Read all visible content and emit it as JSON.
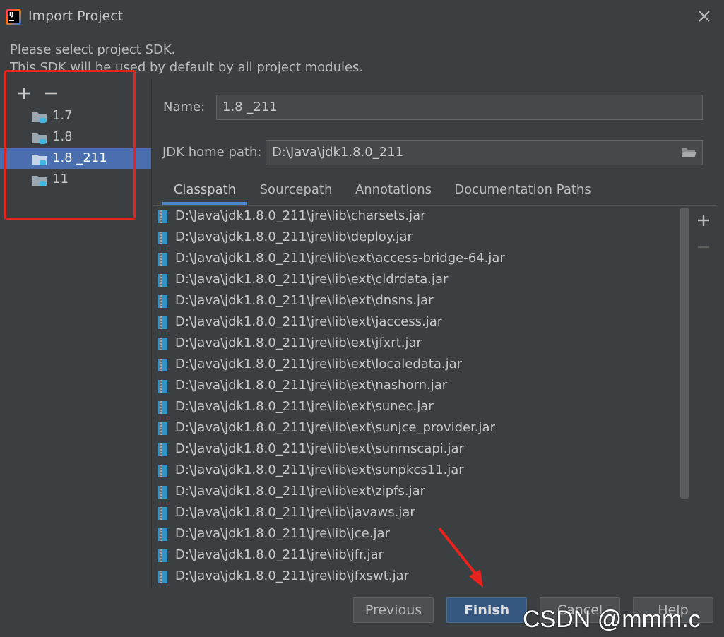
{
  "window": {
    "title": "Import Project"
  },
  "description": {
    "line1": "Please select project SDK.",
    "line2": "This SDK will be used by default by all project modules."
  },
  "sdk_list": [
    {
      "label": "1.7",
      "selected": false
    },
    {
      "label": "1.8",
      "selected": false
    },
    {
      "label": "1.8 _211",
      "selected": true
    },
    {
      "label": "11",
      "selected": false
    }
  ],
  "form": {
    "name_label": "Name:",
    "name_value": "1.8 _211",
    "jdk_label": "JDK home path:",
    "jdk_value": "D:\\Java\\jdk1.8.0_211"
  },
  "tabs": [
    {
      "label": "Classpath",
      "active": true
    },
    {
      "label": "Sourcepath",
      "active": false
    },
    {
      "label": "Annotations",
      "active": false
    },
    {
      "label": "Documentation Paths",
      "active": false
    }
  ],
  "classpath": [
    "D:\\Java\\jdk1.8.0_211\\jre\\lib\\charsets.jar",
    "D:\\Java\\jdk1.8.0_211\\jre\\lib\\deploy.jar",
    "D:\\Java\\jdk1.8.0_211\\jre\\lib\\ext\\access-bridge-64.jar",
    "D:\\Java\\jdk1.8.0_211\\jre\\lib\\ext\\cldrdata.jar",
    "D:\\Java\\jdk1.8.0_211\\jre\\lib\\ext\\dnsns.jar",
    "D:\\Java\\jdk1.8.0_211\\jre\\lib\\ext\\jaccess.jar",
    "D:\\Java\\jdk1.8.0_211\\jre\\lib\\ext\\jfxrt.jar",
    "D:\\Java\\jdk1.8.0_211\\jre\\lib\\ext\\localedata.jar",
    "D:\\Java\\jdk1.8.0_211\\jre\\lib\\ext\\nashorn.jar",
    "D:\\Java\\jdk1.8.0_211\\jre\\lib\\ext\\sunec.jar",
    "D:\\Java\\jdk1.8.0_211\\jre\\lib\\ext\\sunjce_provider.jar",
    "D:\\Java\\jdk1.8.0_211\\jre\\lib\\ext\\sunmscapi.jar",
    "D:\\Java\\jdk1.8.0_211\\jre\\lib\\ext\\sunpkcs11.jar",
    "D:\\Java\\jdk1.8.0_211\\jre\\lib\\ext\\zipfs.jar",
    "D:\\Java\\jdk1.8.0_211\\jre\\lib\\javaws.jar",
    "D:\\Java\\jdk1.8.0_211\\jre\\lib\\jce.jar",
    "D:\\Java\\jdk1.8.0_211\\jre\\lib\\jfr.jar",
    "D:\\Java\\jdk1.8.0_211\\jre\\lib\\jfxswt.jar"
  ],
  "buttons": {
    "previous": "Previous",
    "finish": "Finish",
    "cancel": "Cancel",
    "help": "Help"
  },
  "watermark": "CSDN @mmm.c",
  "colors": {
    "background": "#3c3f41",
    "selection": "#4b6eaf",
    "annotation_red": "#e8231d",
    "default_button": "#365880",
    "tab_underline": "#4a88c7"
  },
  "icons": {
    "app": "intellij-idea-icon",
    "close": "close-icon",
    "add": "plus-icon",
    "remove": "minus-icon",
    "sdk": "jdk-folder-icon",
    "browse": "folder-open-icon",
    "jar": "jar-icon"
  }
}
